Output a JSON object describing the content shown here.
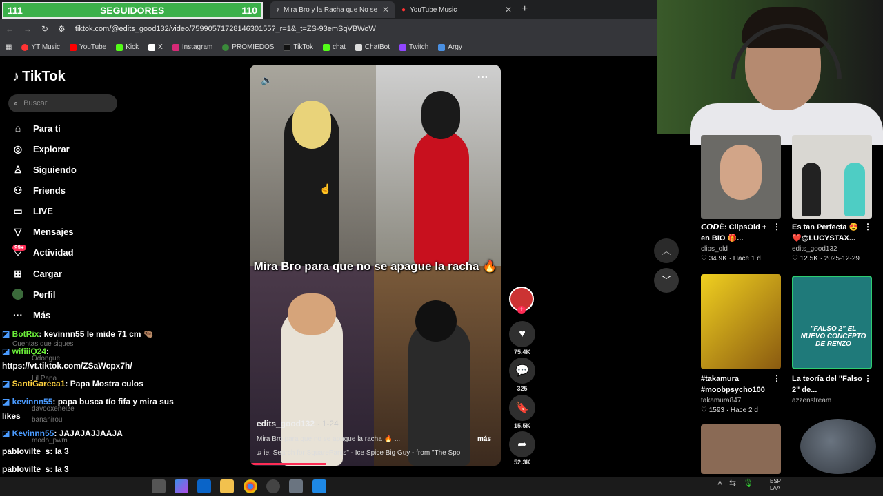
{
  "followers_widget": {
    "left_count": "111",
    "label": "SEGUIDORES",
    "right_count": "110"
  },
  "browser": {
    "tabs": [
      {
        "label": "Mira Bro y la Racha que No se"
      },
      {
        "label": "YouTube Music"
      }
    ],
    "new_tab_label": "+",
    "url": "tiktok.com/@edits_good132/video/7599057172814630155?_r=1&_t=ZS-93emSqVBWoW",
    "bookmarks": [
      "YT Music",
      "YouTube",
      "Kick",
      "X",
      "Instagram",
      "PROMIEDOS",
      "TikTok",
      "chat",
      "ChatBot",
      "Twitch",
      "Argy"
    ]
  },
  "tiktok": {
    "logo": "TikTok",
    "search_placeholder": "Buscar",
    "nav": [
      {
        "label": "Para ti",
        "icon": "home-icon"
      },
      {
        "label": "Explorar",
        "icon": "compass-icon"
      },
      {
        "label": "Siguiendo",
        "icon": "following-icon"
      },
      {
        "label": "Friends",
        "icon": "friends-icon"
      },
      {
        "label": "LIVE",
        "icon": "live-icon"
      },
      {
        "label": "Mensajes",
        "icon": "inbox-icon"
      },
      {
        "label": "Actividad",
        "icon": "activity-icon"
      },
      {
        "label": "Cargar",
        "icon": "upload-icon"
      },
      {
        "label": "Perfil",
        "icon": "profile-icon"
      },
      {
        "label": "Más",
        "icon": "more-icon"
      }
    ],
    "activity_badge": "99+",
    "ghost_texts": [
      "Cuentas que sigues",
      "Odongue",
      "Lil Papa",
      "davooxeneize",
      "bananirou",
      "modo_pwm"
    ]
  },
  "chat": [
    {
      "user": "BotRix",
      "message": ": kevinnn55 le mide 71 cm 🤏🏽"
    },
    {
      "user": "wifiiiQ24",
      "message": ":"
    },
    {
      "user": "",
      "message": "https://vt.tiktok.com/ZSaWcpx7h/"
    },
    {
      "user": "SantiGareca1",
      "message": ": Papa Mostra culos"
    },
    {
      "user": "kevinnn55",
      "message": ": papa busca tío fifa y mira sus"
    },
    {
      "user": "",
      "message": "likes"
    },
    {
      "user": "Kevinnn55",
      "message": ": JAJAJAJJAAJA"
    },
    {
      "user": "pablovilte_s",
      "message": ": la 3"
    },
    {
      "user": "pablovilte_s",
      "message": ": la 3"
    },
    {
      "user": "pablovilte_s",
      "message": ": la 3"
    }
  ],
  "video": {
    "overlay_text": "Mira Bro para que no se apague la racha 🔥",
    "author": "edits_good132",
    "date": "· 1-24",
    "description": "Mira Bro para que no se apague la racha 🔥 ...",
    "more_label": "más",
    "music": "♫  ie: Search for SquarePants\" - Ice Spice   Big Guy - from \"The Spo",
    "likes": "75.4K",
    "comments": "325",
    "saves": "15.5K",
    "shares": "52.3K"
  },
  "recommendations": [
    {
      "title": "𝘾𝙊𝘿Ě: ClipsOld + en BIO 🎁...",
      "author": "clips_old",
      "meta": "♡ 34.9K · Hace 1 d",
      "color": "#6b6a66"
    },
    {
      "title": "Es tan Perfecta 😍❤️@LUCYSTAX...",
      "author": "edits_good132",
      "meta": "♡ 12.5K · 2025-12-29",
      "color": "#d9d7d2"
    },
    {
      "title": "#takamura #moobpsycho100",
      "author": "takamura847",
      "meta": "♡ 1593 · Hace 2 d",
      "color": "#c9a11a"
    },
    {
      "title": "La teoría del \"Falso 2\" de...",
      "author": "azzenstream",
      "meta": "",
      "color": "#1f7a7a",
      "thumb_text": "\"FALSO 2\" EL NUEVO CONCEPTO DE RENZO"
    },
    {
      "title": "",
      "author": "",
      "meta": "",
      "color": "#8a6a55"
    }
  ],
  "taskbar": {
    "lang_line1": "ESP",
    "lang_line2": "LAA"
  }
}
